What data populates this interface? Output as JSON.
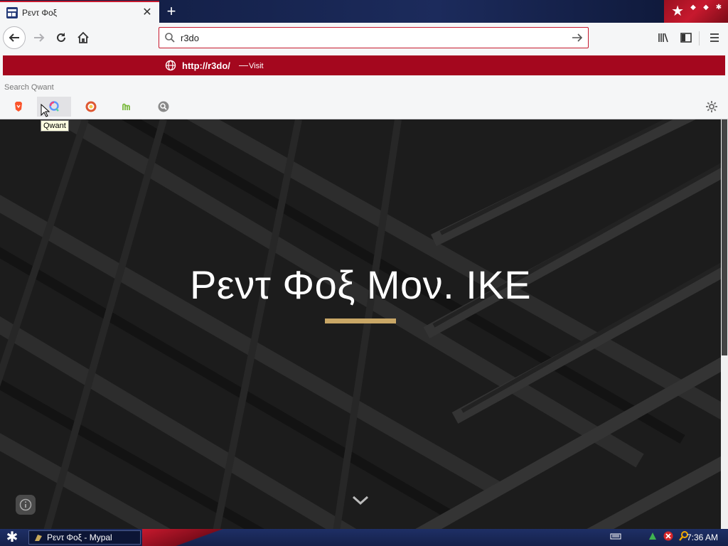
{
  "browser": {
    "tab": {
      "title": "Ρεντ Φοξ",
      "close": "✕"
    },
    "new_tab": "+",
    "window_controls": [
      "◆",
      "◆",
      "✱"
    ],
    "url_input": {
      "value": "r3do"
    },
    "visit_row": {
      "url": "http://r3do/",
      "dash": "—",
      "action": "Visit"
    },
    "search_label": "Search Qwant",
    "engines": [
      {
        "name": "brave",
        "icon": "brave-icon",
        "color": "#fb542b"
      },
      {
        "name": "qwant",
        "icon": "qwant-icon",
        "color": "#5c97ff"
      },
      {
        "name": "duckduckgo",
        "icon": "duckduckgo-icon",
        "color": "#de5833"
      },
      {
        "name": "mojeek",
        "icon": "mojeek-icon",
        "color": "#7ab93d"
      },
      {
        "name": "search",
        "icon": "magnifier-icon",
        "color": "#8a8a8a"
      }
    ],
    "tooltip": "Qwant",
    "accent_color": "#c7192e"
  },
  "page": {
    "hero_title": "Ρεντ Φοξ Μον. ΙΚΕ",
    "underline_color": "#c9a766"
  },
  "taskbar": {
    "start": "✱",
    "task_item": "Ρεντ Φοξ - Mypal",
    "clock": "7:36 AM"
  }
}
